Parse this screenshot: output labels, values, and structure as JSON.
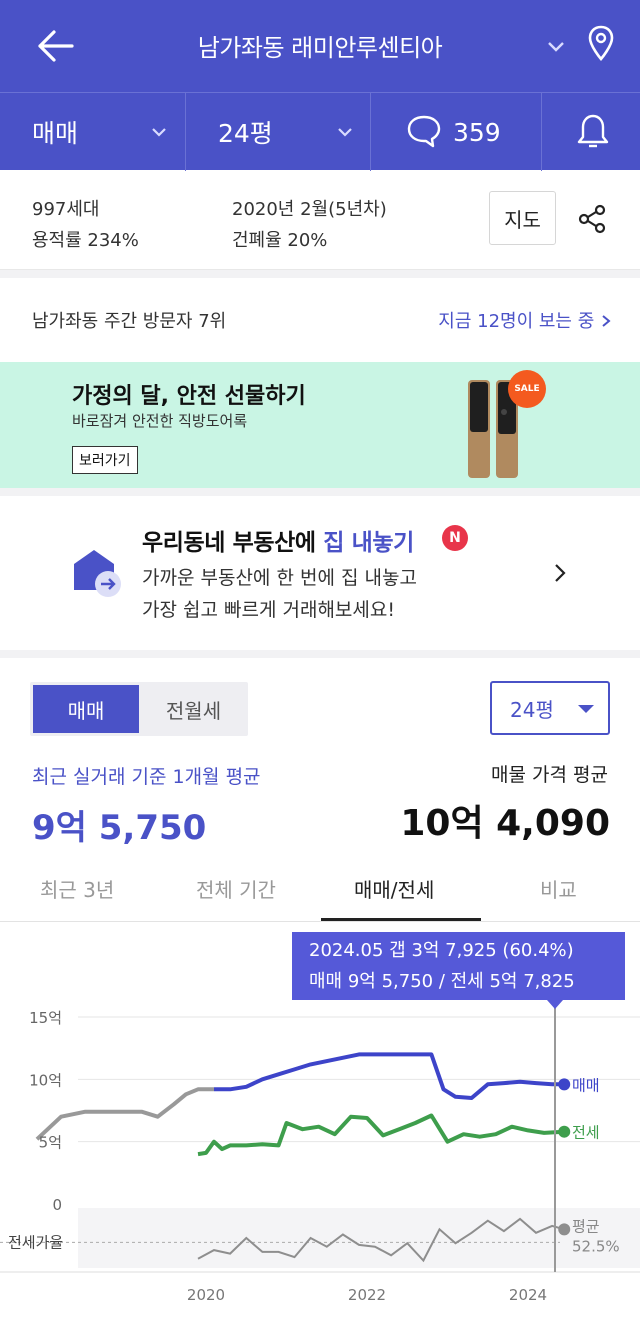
{
  "header": {
    "title": "남가좌동 래미안루센티아"
  },
  "subbar": {
    "trade_type": "매매",
    "size": "24평",
    "comment_count": "359"
  },
  "info": {
    "households": "997세대",
    "completion": "2020년 2월(5년차)",
    "far": "용적률 234%",
    "bcr": "건폐율 20%",
    "map_button": "지도"
  },
  "rank": {
    "label": "남가좌동 주간 방문자 7위",
    "viewers": "지금 12명이 보는 중 "
  },
  "banner": {
    "title": "가정의 달, 안전 선물하기",
    "subtitle": "바로잠겨 안전한 직방도어록",
    "button": "보러가기",
    "sale_badge": "SALE"
  },
  "promo": {
    "title_prefix": "우리동네 부동산에 ",
    "title_accent": "집 내놓기",
    "badge": "N",
    "line1": "가까운 부동산에 한 번에 집 내놓고",
    "line2": "가장 쉽고 빠르게 거래해보세요!"
  },
  "trade": {
    "seg_on": "매매",
    "seg_off": "전월세",
    "size_select": "24평",
    "recent_label": "최근 실거래 기준 1개월 평균",
    "recent_value": "9억 5,750",
    "ask_label": "매물 가격 평균",
    "ask_value": "10억 4,090"
  },
  "tabs": [
    "최근 3년",
    "전체 기간",
    "매매/전세",
    "비교"
  ],
  "tooltip": {
    "line1": "2024.05  갭 3억 7,925 (60.4%)",
    "line2": "매매 9억 5,750 / 전세 5억 7,825"
  },
  "colors": {
    "brand": "#4a52c7",
    "sale_line": "#3d44c9",
    "jeonse_line": "#3e9e4c",
    "history_line": "#999999",
    "banner_bg": "#c9f5e4"
  },
  "chart_data": {
    "type": "line",
    "y_ticks": [
      "15억",
      "10억",
      "5억",
      "0"
    ],
    "x_ticks": [
      "2020",
      "2022",
      "2024"
    ],
    "ratio_label": "전세가율",
    "avg_label": "평균",
    "avg_value": "52.5%",
    "ylim": [
      0,
      15
    ],
    "series": [
      {
        "name": "매매",
        "unit": "억",
        "x": [
          2017.9,
          2018.2,
          2018.5,
          2018.8,
          2019.0,
          2019.2,
          2019.4,
          2019.6,
          2019.75,
          2019.9,
          2020.1,
          2020.3,
          2020.5,
          2020.7,
          2020.9,
          2021.1,
          2021.3,
          2021.6,
          2021.9,
          2022.2,
          2022.5,
          2022.8,
          2022.95,
          2023.1,
          2023.3,
          2023.5,
          2023.7,
          2023.9,
          2024.1,
          2024.3,
          2024.45
        ],
        "values": [
          5.2,
          7.0,
          7.4,
          7.4,
          7.4,
          7.4,
          7.0,
          8.0,
          8.8,
          9.2,
          9.2,
          9.2,
          9.4,
          10.0,
          10.4,
          10.8,
          11.2,
          11.6,
          12.0,
          12.0,
          12.0,
          12.0,
          9.2,
          8.6,
          8.5,
          9.6,
          9.7,
          9.8,
          9.7,
          9.6,
          9.6
        ]
      },
      {
        "name": "전세",
        "unit": "억",
        "x": [
          2019.9,
          2020.0,
          2020.1,
          2020.2,
          2020.3,
          2020.5,
          2020.7,
          2020.9,
          2021.0,
          2021.2,
          2021.4,
          2021.6,
          2021.8,
          2022.0,
          2022.2,
          2022.4,
          2022.6,
          2022.8,
          2023.0,
          2023.2,
          2023.4,
          2023.6,
          2023.8,
          2024.0,
          2024.2,
          2024.45
        ],
        "values": [
          4.0,
          4.1,
          5.0,
          4.4,
          4.7,
          4.7,
          4.8,
          4.7,
          6.5,
          6.0,
          6.2,
          5.6,
          7.0,
          6.9,
          5.5,
          6.0,
          6.5,
          7.1,
          5.0,
          5.6,
          5.4,
          5.6,
          6.2,
          5.9,
          5.7,
          5.8
        ]
      },
      {
        "name": "전세가율",
        "unit": "%",
        "x": [
          2019.9,
          2020.1,
          2020.3,
          2020.5,
          2020.7,
          2020.9,
          2021.1,
          2021.3,
          2021.5,
          2021.7,
          2021.9,
          2022.1,
          2022.3,
          2022.5,
          2022.7,
          2022.9,
          2023.1,
          2023.3,
          2023.5,
          2023.7,
          2023.9,
          2024.1,
          2024.3,
          2024.45
        ],
        "values": [
          43,
          48,
          46,
          55,
          47,
          47,
          44,
          55,
          50,
          57,
          51,
          50,
          45,
          52,
          42,
          60,
          52,
          58,
          65,
          59,
          66,
          58,
          62,
          60
        ]
      }
    ]
  }
}
